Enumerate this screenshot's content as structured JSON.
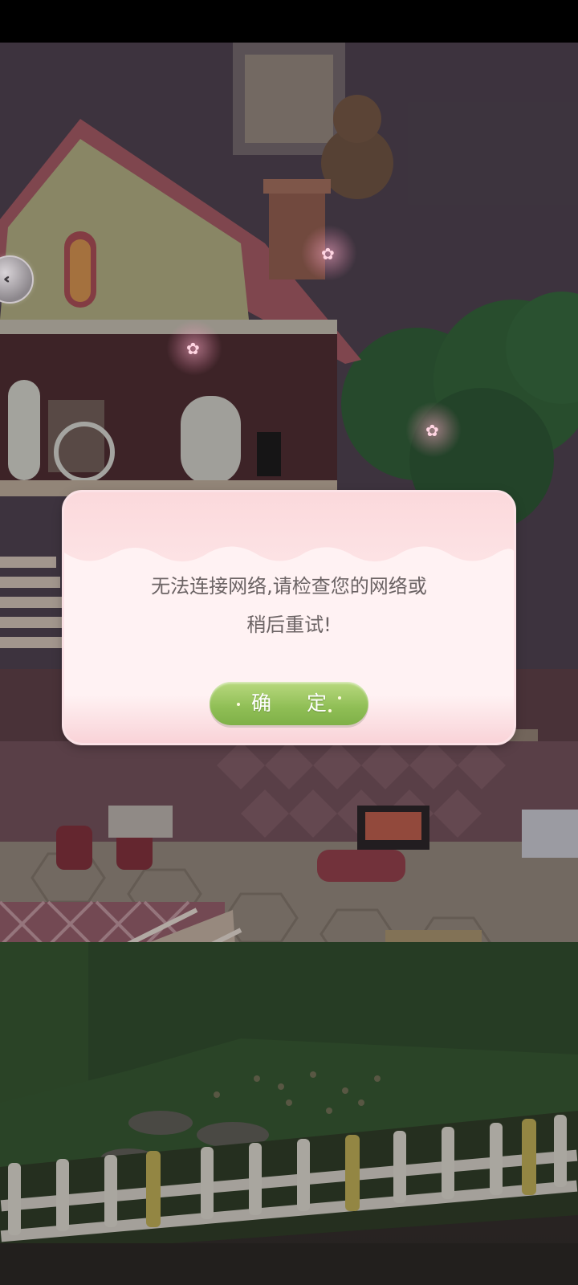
{
  "dialog": {
    "message_line1": "无法连接网络,请检查您的网络或",
    "message_line2": "稍后重试!",
    "confirm_label": "确 定"
  },
  "colors": {
    "dialog_bg": "#fff2f3",
    "dialog_header": "#fbd9dc",
    "confirm_button": "#8fbe55",
    "message_text": "#6c6465"
  },
  "icons": {
    "back": "double-chevron-left-icon",
    "sparkle": "flower-petal-icon"
  }
}
